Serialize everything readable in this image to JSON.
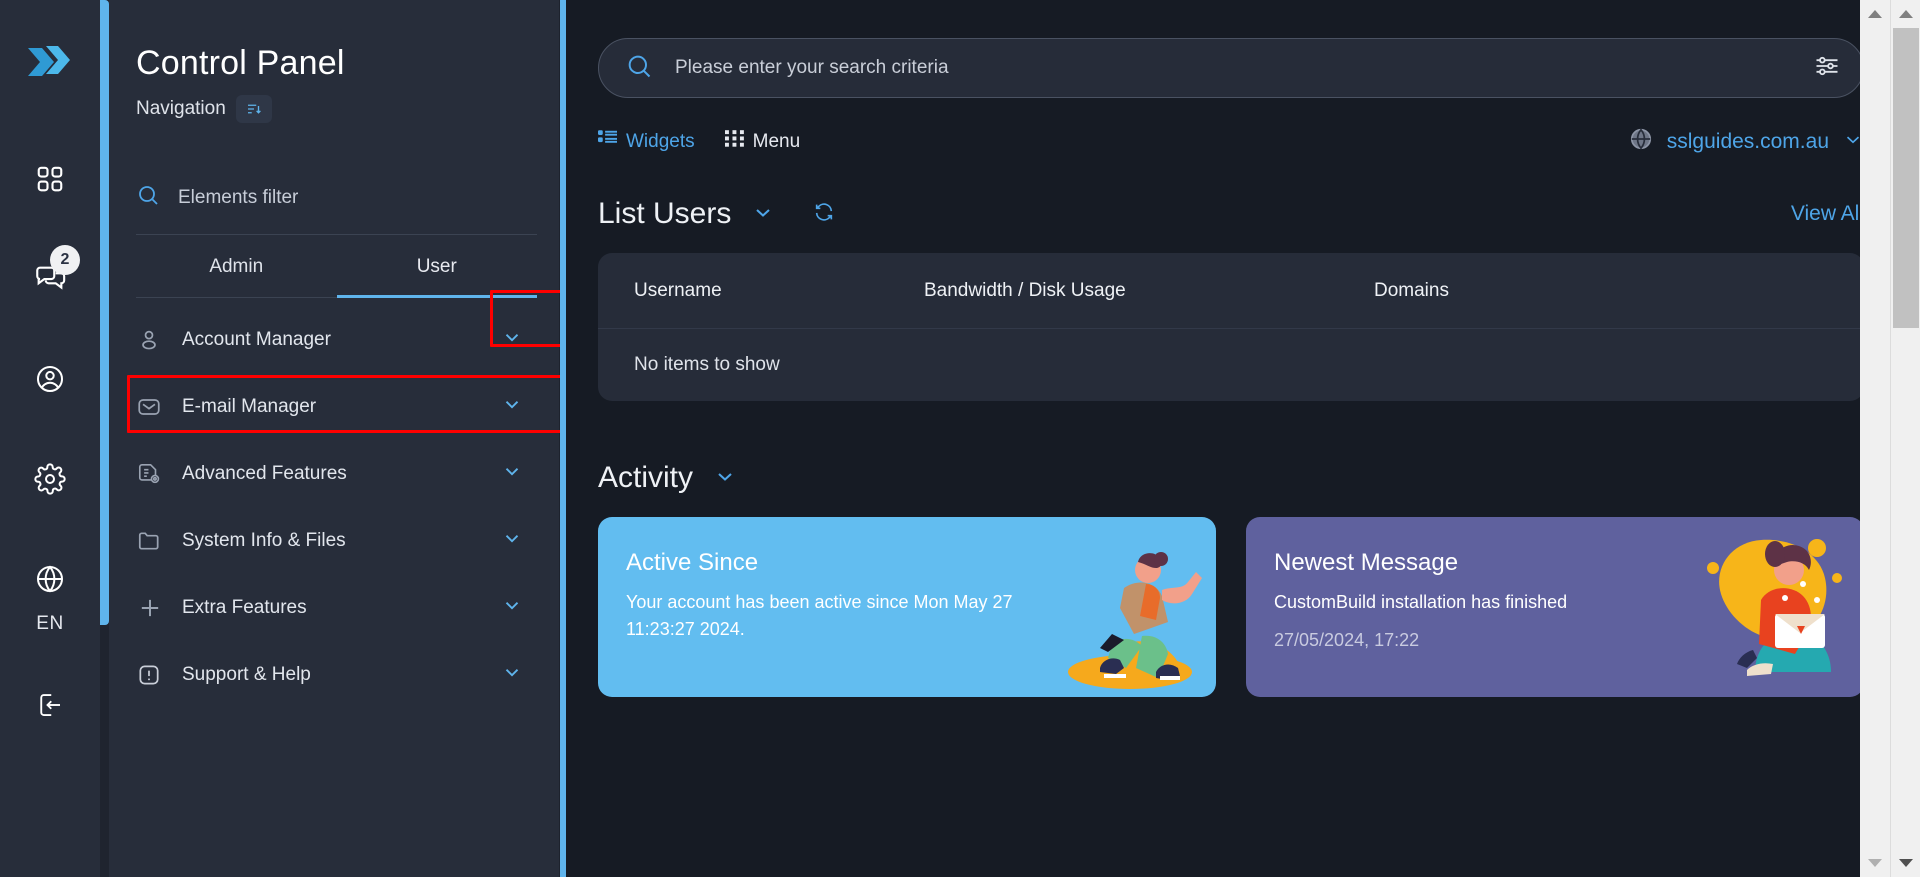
{
  "rail": {
    "logo_icon": "directadmin-logo-icon",
    "items": [
      {
        "icon": "grid-apps-icon",
        "name": "apps"
      },
      {
        "icon": "chat-bubbles-icon",
        "name": "messages",
        "badge": "2"
      },
      {
        "icon": "user-circle-icon",
        "name": "account"
      },
      {
        "icon": "gear-icon",
        "name": "settings"
      },
      {
        "icon": "globe-icon",
        "name": "language"
      }
    ],
    "language": "EN",
    "logout_icon": "logout-icon"
  },
  "sidebar": {
    "title": "Control Panel",
    "subtitle": "Navigation",
    "sort_icon": "sort-list-icon",
    "filter_placeholder": "Elements filter",
    "search_icon": "search-icon",
    "tabs": [
      {
        "label": "Admin",
        "active": false
      },
      {
        "label": "User",
        "active": true
      }
    ],
    "menu": [
      {
        "label": "Account Manager",
        "icon": "user-icon",
        "chevron": "chevron-down-icon",
        "highlighted": true
      },
      {
        "label": "E-mail Manager",
        "icon": "envelope-icon",
        "chevron": "chevron-down-icon",
        "highlighted": false
      },
      {
        "label": "Advanced Features",
        "icon": "document-gear-icon",
        "chevron": "chevron-down-icon",
        "highlighted": false
      },
      {
        "label": "System Info & Files",
        "icon": "folder-icon",
        "chevron": "chevron-down-icon",
        "highlighted": false
      },
      {
        "label": "Extra Features",
        "icon": "plus-icon",
        "chevron": "chevron-down-icon",
        "highlighted": false
      },
      {
        "label": "Support & Help",
        "icon": "exclamation-box-icon",
        "chevron": "chevron-down-icon",
        "highlighted": false
      }
    ]
  },
  "main": {
    "search": {
      "placeholder": "Please enter your search criteria",
      "value": "",
      "search_icon": "search-icon",
      "filter_icon": "sliders-filter-icon"
    },
    "toolbar": {
      "widgets_label": "Widgets",
      "widgets_icon": "widgets-grid-icon",
      "menu_label": "Menu",
      "menu_icon": "menu-grid-icon",
      "domain": "sslguides.com.au",
      "domain_icon": "globe-icon",
      "domain_caret": "chevron-down-icon"
    },
    "list_users": {
      "title": "List Users",
      "caret_icon": "chevron-down-icon",
      "refresh_icon": "refresh-icon",
      "view_all": "View All",
      "columns": [
        "Username",
        "Bandwidth / Disk Usage",
        "Domains"
      ],
      "empty_text": "No items to show"
    },
    "activity": {
      "title": "Activity",
      "caret_icon": "chevron-down-icon",
      "cards": [
        {
          "title": "Active Since",
          "text": "Your account has been active since Mon May 27 11:23:27 2024.",
          "date": "",
          "color": "#62bdf0",
          "art": "running-person-illustration"
        },
        {
          "title": "Newest Message",
          "text": "CustomBuild installation has finished",
          "date": "27/05/2024, 17:22",
          "color": "#5f619e",
          "art": "sitting-person-illustration"
        }
      ]
    }
  },
  "colors": {
    "accent": "#4ea5e8",
    "highlight": "#fe0000",
    "sidebar_bg": "#272d3a",
    "main_bg": "#161b24"
  }
}
